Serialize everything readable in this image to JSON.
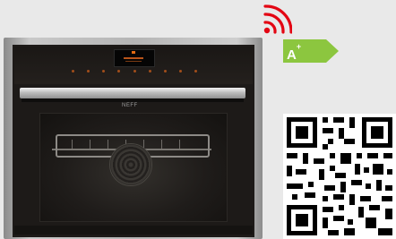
{
  "product": {
    "brand_label": "NEFF",
    "energy_class": {
      "grade": "A",
      "plus": "+",
      "color": "#8cc63f"
    },
    "connectivity_icon": "wifi-icon",
    "connectivity_color": "#e30613"
  },
  "colors": {
    "background": "#e9e9e9",
    "oven_black": "#1d1a18",
    "stainless": "#b5b5b5",
    "display_orange": "#e36a12"
  }
}
